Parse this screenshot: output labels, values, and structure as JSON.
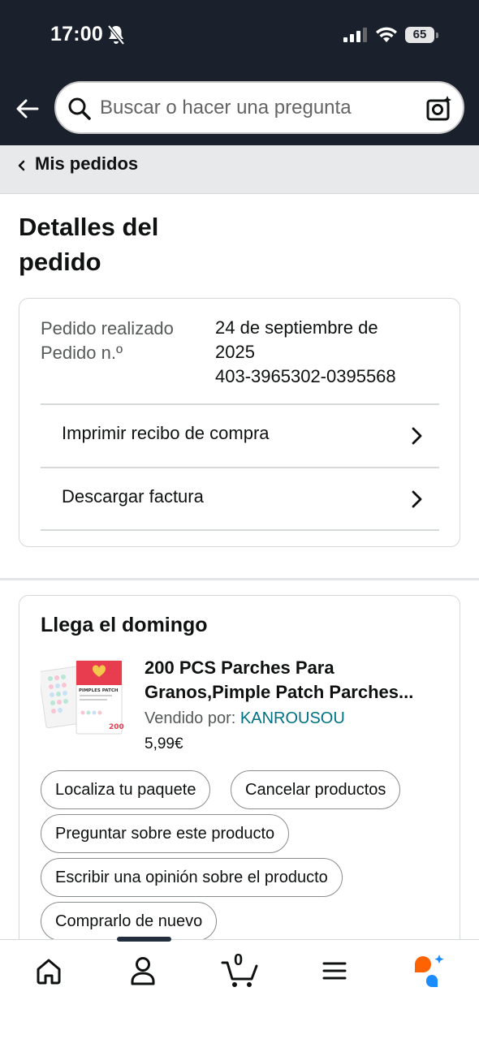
{
  "status_bar": {
    "time": "17:00",
    "battery": "65"
  },
  "header": {
    "search_placeholder": "Buscar o hacer una pregunta"
  },
  "breadcrumb": {
    "label": "Mis pedidos"
  },
  "page": {
    "title": "Detalles del pedido"
  },
  "order_info": {
    "placed_label": "Pedido realizado",
    "number_label": "Pedido n.º",
    "placed_value_line1": "24 de septiembre de",
    "placed_value_line2": "2025",
    "number_value": "403-3965302-0395568"
  },
  "order_actions": [
    {
      "label": "Imprimir recibo de compra"
    },
    {
      "label": "Descargar factura"
    }
  ],
  "shipment": {
    "title": "Llega el domingo",
    "product": {
      "name_line1": "200 PCS Parches Para",
      "name_line2": "Granos,Pimple Patch Parches...",
      "seller_label": "Vendido por:",
      "seller_name": "KANROUSOU",
      "price": "5,99€",
      "image_brand": "PIMPLES PATCH",
      "image_count": "200"
    },
    "buttons": [
      {
        "label": "Localiza tu paquete"
      },
      {
        "label": "Cancelar productos"
      },
      {
        "label": "Preguntar sobre este producto"
      },
      {
        "label": "Escribir una opinión sobre el producto"
      },
      {
        "label": "Comprarlo de nuevo"
      }
    ]
  },
  "bottom_nav": {
    "items": [
      "home-icon",
      "account-icon",
      "cart-icon",
      "menu-icon",
      "rufus-ai-icon"
    ],
    "cart_count": "0"
  },
  "colors": {
    "header_bg": "#1a212c",
    "link": "#007185",
    "breadcrumb_bg": "#e7e9ea",
    "ai_orange": "#ff6200",
    "ai_blue": "#1a8cff"
  }
}
